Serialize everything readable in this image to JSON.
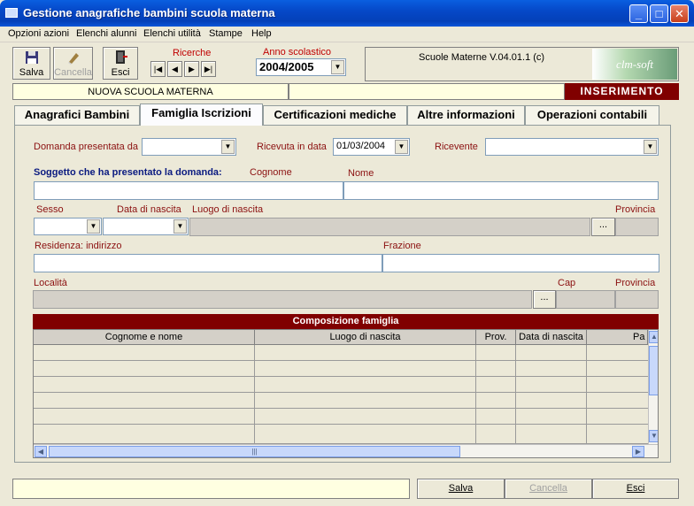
{
  "window": {
    "title": "Gestione anagrafiche bambini scuola materna",
    "minimize": "_",
    "maximize": "□",
    "close": "✕"
  },
  "menu": [
    "Opzioni azioni",
    "Elenchi alunni",
    "Elenchi utilità",
    "Stampe",
    "Help"
  ],
  "toolbar": {
    "save_label": "Salva",
    "cancel_label": "Cancella",
    "exit_label": "Esci",
    "searches_label": "Ricerche",
    "nav": {
      "first": "|◀",
      "prev": "◀",
      "next": "▶",
      "last": "▶|"
    },
    "school_year_label": "Anno scolastico",
    "school_year_value": "2004/2005"
  },
  "info": {
    "version": "Scuole Materne V.04.01.1 (c)",
    "logo": "clm-soft"
  },
  "status": {
    "school_name": "NUOVA SCUOLA MATERNA",
    "mode": "INSERIMENTO"
  },
  "tabs": [
    "Anagrafici Bambini",
    "Famiglia Iscrizioni",
    "Certificazioni mediche",
    "Altre informazioni",
    "Operazioni contabili"
  ],
  "form": {
    "submitted_by_label": "Domanda presentata da",
    "received_date_label": "Ricevuta in data",
    "received_date_value": "01/03/2004",
    "recipient_label": "Ricevente",
    "applicant_label": "Soggetto che ha presentato la domanda:",
    "surname_label": "Cognome",
    "name_label": "Nome",
    "sex_label": "Sesso",
    "birth_date_label": "Data di nascita",
    "birth_place_label": "Luogo di nascita",
    "province_label": "Provincia",
    "residence_label": "Residenza: indirizzo",
    "hamlet_label": "Frazione",
    "locality_label": "Località",
    "zip_label": "Cap",
    "province2_label": "Provincia",
    "dots": "..."
  },
  "family_grid": {
    "title": "Composizione famiglia",
    "columns": [
      "Cognome e nome",
      "Luogo di nascita",
      "Prov.",
      "Data di nascita",
      "Pa"
    ]
  },
  "footer": {
    "save_label": "Salva",
    "cancel_label": "Cancella",
    "exit_label": "Esci"
  }
}
